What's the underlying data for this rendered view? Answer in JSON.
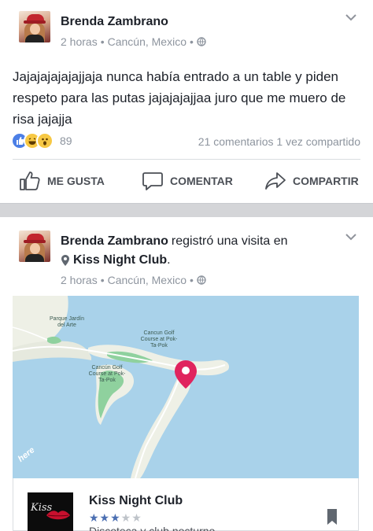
{
  "post1": {
    "author": "Brenda Zambrano",
    "time": "2 horas",
    "dot": "•",
    "location": "Cancún, Mexico",
    "text": "Jajajajajajajjaja nunca había entrado a un table y piden respeto para las putas jajajajajjaa juro que me muero de risa jajajja",
    "reaction_count": "89",
    "comments": "21 comentarios",
    "shares": "1 vez compartido",
    "actions": {
      "like": "ME GUSTA",
      "comment": "COMENTAR",
      "share": "COMPARTIR"
    }
  },
  "post2": {
    "author": "Brenda Zambrano",
    "checkin_text": "registró una visita en",
    "place": "Kiss Night Club",
    "period": ".",
    "time": "2 horas",
    "dot": "•",
    "location": "Cancún, Mexico",
    "map": {
      "labels": {
        "park": "Parque Jardín del Arte",
        "golf1": "Cancun Golf Course at Pok-Ta-Pok",
        "golf2": "Cancún Golf Course at Pok-Ta-Pok",
        "watermark": "here"
      },
      "water_color": "#a9d2ea",
      "land_color": "#eef0e6",
      "park_color": "#8fd19e",
      "pin_color": "#e0245e"
    },
    "card": {
      "title": "Kiss Night Club",
      "rating": 3,
      "max_rating": 5,
      "category": "Discoteca y club nocturno",
      "thumb_text": "Kiss"
    }
  }
}
